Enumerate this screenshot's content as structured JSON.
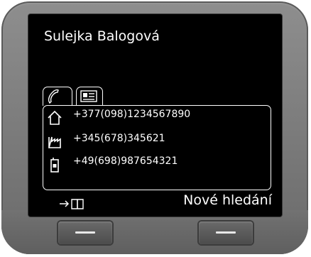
{
  "contact": {
    "name": "Sulejka Balogová"
  },
  "tabs": [
    {
      "icon": "phone-handset-icon",
      "selected": true
    },
    {
      "icon": "contact-card-icon",
      "selected": false
    }
  ],
  "entries": [
    {
      "type": "home",
      "icon": "home-icon",
      "number": "+377(098)1234567890"
    },
    {
      "type": "office",
      "icon": "office-factory-icon",
      "number": "+345(678)345621"
    },
    {
      "type": "mobile",
      "icon": "mobile-phone-icon",
      "number": "+49(698)987654321"
    }
  ],
  "softkeys": {
    "left_icon": "copy-to-directory-icon",
    "right_label": "Nové hledání"
  }
}
